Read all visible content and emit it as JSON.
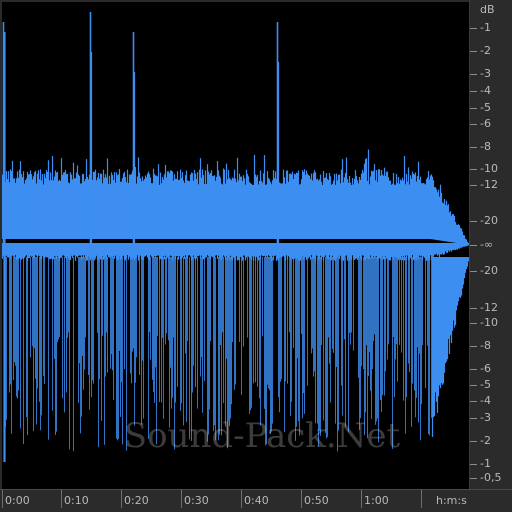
{
  "colors": {
    "waveform": "#3d8ef0",
    "background": "#000000",
    "ruler": "#2b2b2b",
    "ruler_text": "#b8b8b8"
  },
  "db_scale": {
    "unit_label": "dB",
    "top_labels": [
      "-1",
      "-2",
      "-3",
      "-4",
      "-5",
      "-6",
      "-8",
      "-10",
      "-12",
      "-20"
    ],
    "center_label": "-∞",
    "bottom_labels": [
      "-20",
      "-12",
      "-10",
      "-8",
      "-6",
      "-5",
      "-4",
      "-3",
      "-2",
      "-1",
      "-0,5"
    ]
  },
  "time_scale": {
    "labels": [
      "0:00",
      "0:10",
      "0:20",
      "0:30",
      "0:40",
      "0:50",
      "1:00"
    ],
    "unit_label": "h:m:s"
  },
  "watermark": "Sound-Pack.Net"
}
